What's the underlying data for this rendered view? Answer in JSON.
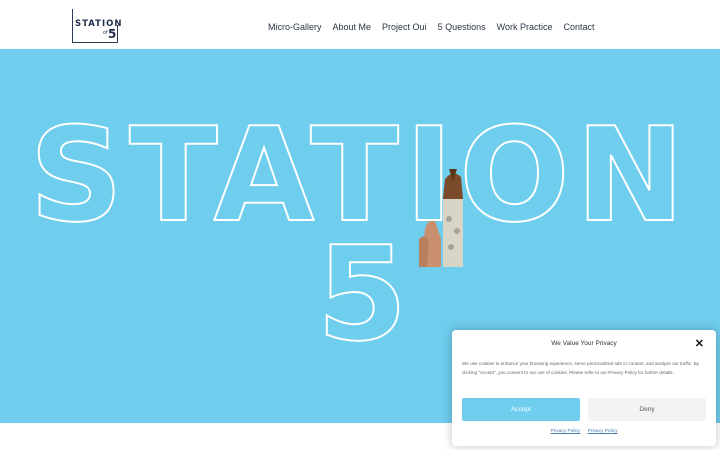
{
  "logo": {
    "line1": "STATION",
    "of": "of",
    "num": "5"
  },
  "nav": {
    "items": [
      "Micro-Gallery",
      "About Me",
      "Project Oui",
      "5 Questions",
      "Work Practice",
      "Contact"
    ]
  },
  "hero": {
    "word": "STATION",
    "number": "5",
    "bg": "#6fcdee",
    "outline": "#ffffff"
  },
  "consent": {
    "title": "We Value Your Privacy",
    "close": "✕",
    "body": "We use cookies to enhance your browsing experience, serve personalized ads or content, and analyze our traffic. By clicking \"Accept\", you consent to our use of cookies. Please refer to our Privacy Policy for further details.",
    "accept": "Accept",
    "deny": "Deny",
    "links": [
      "Privacy Policy",
      "Privacy Policy"
    ]
  }
}
